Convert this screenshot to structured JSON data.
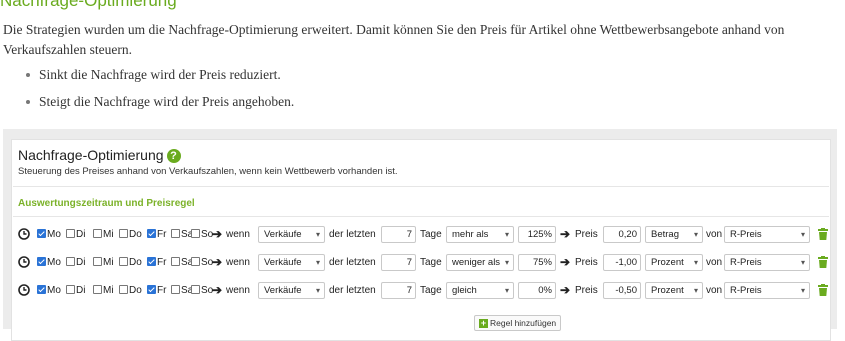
{
  "doc": {
    "title": "Nachfrage-Optimierung",
    "intro": "Die Strategien wurden um die Nachfrage-Optimierung erweitert. Damit können Sie den Preis für Artikel ohne Wettbewerbsangebote anhand von Verkaufszahlen steuern.",
    "bullets": [
      "Sinkt die Nachfrage wird der Preis reduziert.",
      "Steigt die Nachfrage wird der Preis angehoben."
    ]
  },
  "card": {
    "title": "Nachfrage-Optimierung",
    "help_icon": "question-circle-icon",
    "subtitle": "Steuerung des Preises anhand von Verkaufszahlen, wenn kein Wettbewerb vorhanden ist.",
    "section_title": "Auswertungszeitraum und Preisregel",
    "add_button": "Regel hinzufügen"
  },
  "labels": {
    "days": [
      "Mo",
      "Di",
      "Mi",
      "Do",
      "Fr",
      "Sa",
      "So"
    ],
    "wenn": "wenn",
    "der_letzten": "der letzten",
    "tage": "Tage",
    "preis": "Preis",
    "von": "von"
  },
  "rules": [
    {
      "days_checked": [
        true,
        false,
        false,
        false,
        true,
        false,
        false
      ],
      "metric": "Verkäufe",
      "period": "7",
      "comparison": "mehr als",
      "threshold": "125%",
      "price_value": "0,20",
      "price_type": "Betrag",
      "price_base": "R-Preis"
    },
    {
      "days_checked": [
        true,
        false,
        false,
        false,
        true,
        false,
        false
      ],
      "metric": "Verkäufe",
      "period": "7",
      "comparison": "weniger als",
      "threshold": "75%",
      "price_value": "-1,00",
      "price_type": "Prozent",
      "price_base": "R-Preis"
    },
    {
      "days_checked": [
        true,
        false,
        false,
        false,
        true,
        false,
        false
      ],
      "metric": "Verkäufe",
      "period": "7",
      "comparison": "gleich",
      "threshold": "0%",
      "price_value": "-0,50",
      "price_type": "Prozent",
      "price_base": "R-Preis"
    }
  ],
  "colors": {
    "accent_green": "#6aab1f",
    "checkbox_blue": "#2a73d6"
  }
}
